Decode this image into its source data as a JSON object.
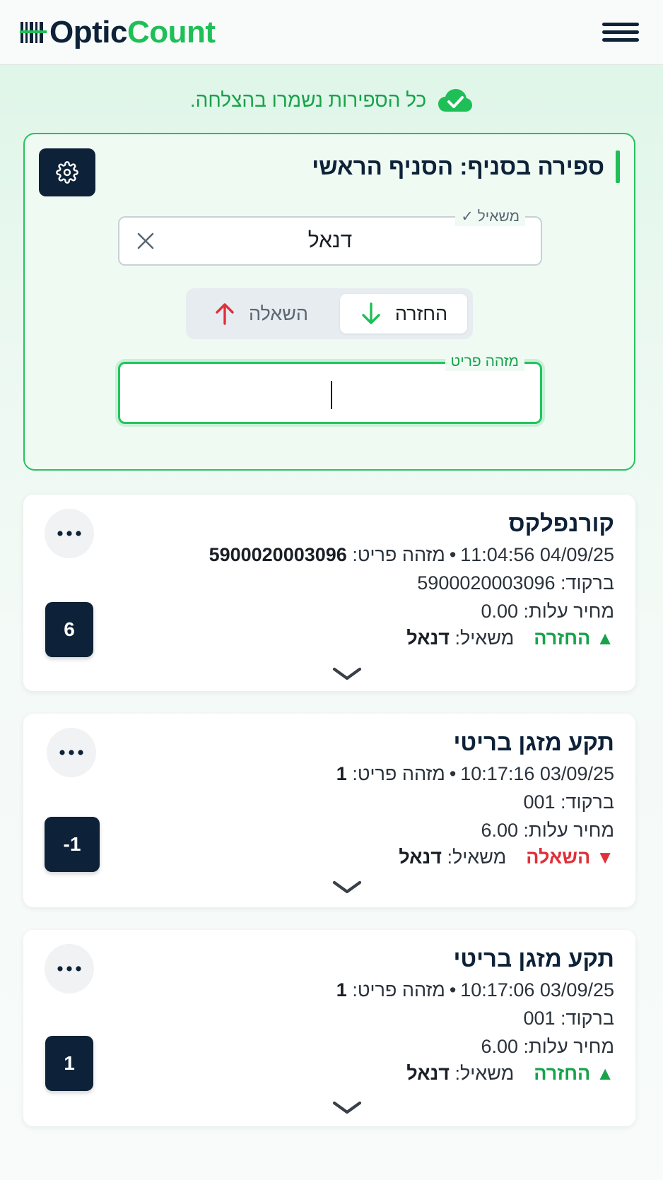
{
  "header": {
    "logo_part1": "Optic",
    "logo_part2": "Count",
    "logo_icon": "barcode-icon",
    "menu_icon": "hamburger-icon"
  },
  "notice": {
    "text": "כל הספירות נשמרו בהצלחה.",
    "icon": "cloud-check-icon"
  },
  "panel": {
    "title": "ספירה בסניף: הסניף הראשי",
    "settings_icon": "gear-icon",
    "borrower_label": "משאיל ✓",
    "borrower_value": "דנאל",
    "toggle": {
      "return_label": "החזרה",
      "loan_label": "השאלה"
    },
    "item_label": "מזהה פריט",
    "item_value": ""
  },
  "labels": {
    "item_id": "מזהה פריט:",
    "barcode": "ברקוד:",
    "cost": "מחיר עלות:",
    "borrower": "משאיל:"
  },
  "entries": [
    {
      "name": "קורנפלקס",
      "date": "04/09/25",
      "time": "11:04:56",
      "item_id": "5900020003096",
      "barcode": "5900020003096",
      "cost": "0.00",
      "status": "החזרה",
      "borrower": "דנאל",
      "qty": "6"
    },
    {
      "name": "תקע מזגן בריטי",
      "date": "03/09/25",
      "time": "10:17:16",
      "item_id": "1",
      "barcode": "001",
      "cost": "6.00",
      "status": "השאלה",
      "borrower": "דנאל",
      "qty": "-1"
    },
    {
      "name": "תקע מזגן בריטי",
      "date": "03/09/25",
      "time": "10:17:06",
      "item_id": "1",
      "barcode": "001",
      "cost": "6.00",
      "status": "החזרה",
      "borrower": "דנאל",
      "qty": "1"
    }
  ],
  "colors": {
    "brand_green": "#1fbf57",
    "brand_navy": "#0d2238",
    "loan_red": "#e0303a"
  }
}
